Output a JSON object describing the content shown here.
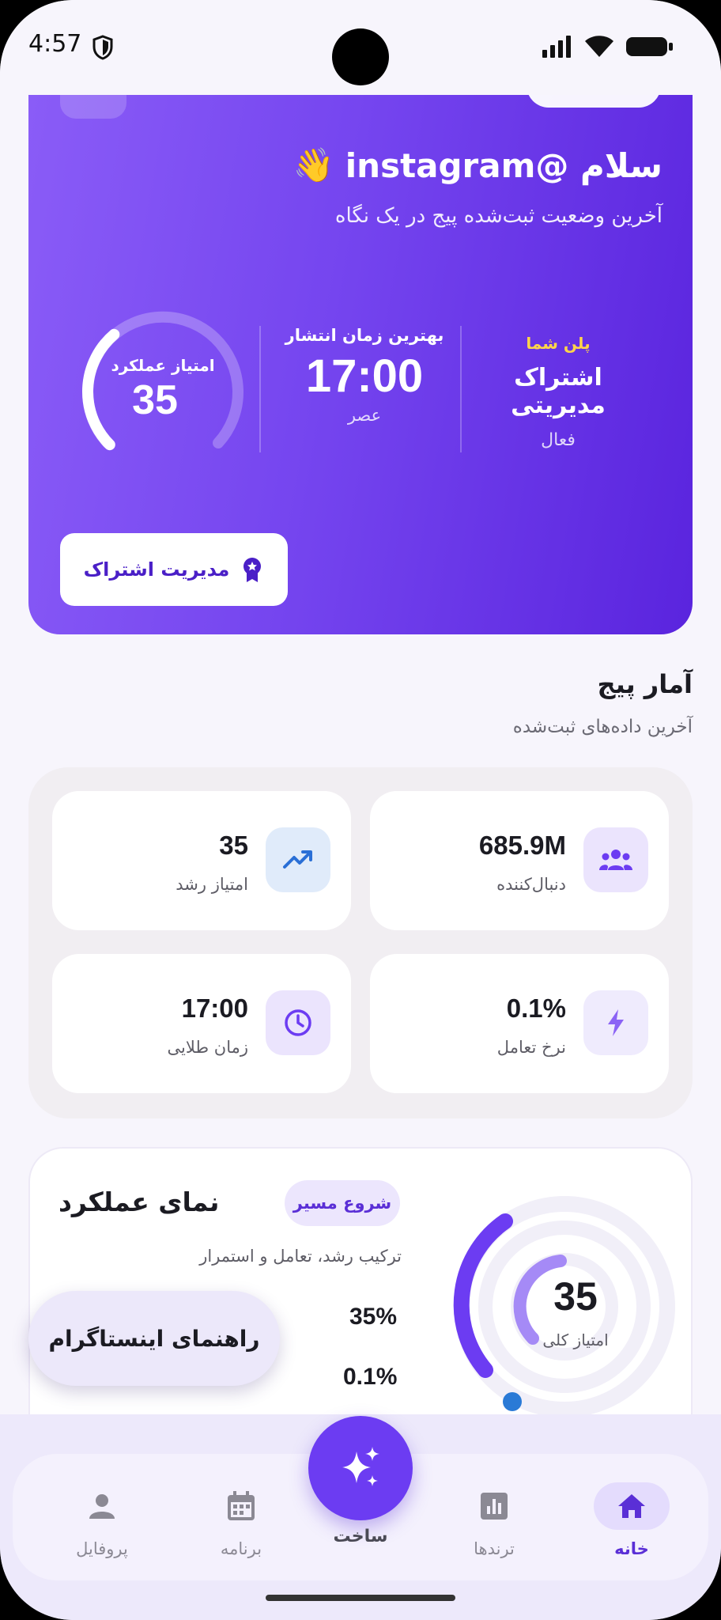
{
  "status_bar": {
    "time": "4:57"
  },
  "hero": {
    "greeting": "سلام @instagram",
    "wave_emoji": "👋",
    "subtitle": "آخرین وضعیت ثبت‌شده پیج در یک نگاه",
    "plan": {
      "label": "پلن شما",
      "name": "اشتراک مدیریتی",
      "status": "فعال"
    },
    "best_time": {
      "label": "بهترین زمان انتشار",
      "value": "17:00",
      "period": "عصر"
    },
    "score": {
      "label": "امتیاز عملکرد",
      "value": "35",
      "fraction": 0.35
    },
    "manage_button": "مدیریت اشتراک"
  },
  "page_stats": {
    "title": "آمار پیج",
    "subtitle": "آخرین داده‌های ثبت‌شده",
    "cards": [
      {
        "value": "685.9M",
        "label": "دنبال‌کننده",
        "icon": "group-icon"
      },
      {
        "value": "35",
        "label": "امتیاز رشد",
        "icon": "trending-up-icon"
      },
      {
        "value": "0.1%",
        "label": "نرخ تعامل",
        "icon": "bolt-icon"
      },
      {
        "value": "17:00",
        "label": "زمان طلایی",
        "icon": "clock-icon"
      }
    ]
  },
  "performance": {
    "title": "نمای عملکرد",
    "badge": "شروع مسیر",
    "subtitle": "ترکیب رشد، تعامل و استمرار",
    "value_1": "35%",
    "value_2": "0.1%",
    "gauge_value": "35",
    "gauge_label": "امتیاز کلی"
  },
  "guide_button": "راهنمای اینستاگرام",
  "nav": {
    "items": [
      {
        "label": "خانه",
        "icon": "home-icon",
        "active": true
      },
      {
        "label": "ترندها",
        "icon": "bar-chart-icon",
        "active": false
      },
      {
        "label": "ساخت",
        "icon": "sparkles-icon",
        "active": false
      },
      {
        "label": "برنامه",
        "icon": "calendar-icon",
        "active": false
      },
      {
        "label": "پروفایل",
        "icon": "person-icon",
        "active": false
      }
    ]
  },
  "colors": {
    "accent": "#6c3cf2",
    "hero_start": "#8a5cf7",
    "hero_end": "#5a24de",
    "plan_label": "#ffd54a"
  }
}
